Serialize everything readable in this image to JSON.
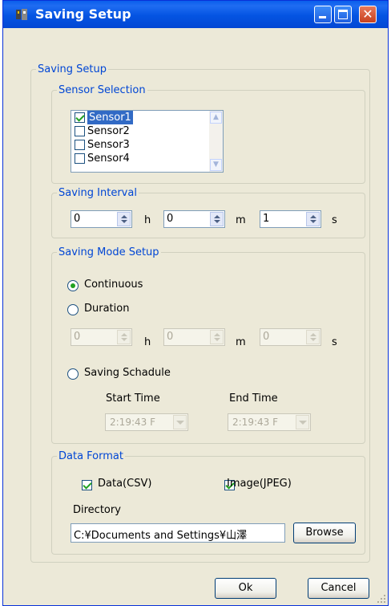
{
  "window": {
    "title": "Saving Setup",
    "close_glyph": "✕",
    "icon": "app-icon",
    "colors": {
      "titlebar": "#0454E2",
      "group_title": "#0046D5",
      "check": "#21A121",
      "selection": "#316AC5"
    }
  },
  "main_group": {
    "title": "Saving Setup"
  },
  "sensor_selection": {
    "title": "Sensor Selection",
    "items": [
      {
        "label": "Sensor1",
        "checked": true,
        "selected": true
      },
      {
        "label": "Sensor2",
        "checked": false,
        "selected": false
      },
      {
        "label": "Sensor3",
        "checked": false,
        "selected": false
      },
      {
        "label": "Sensor4",
        "checked": false,
        "selected": false
      }
    ]
  },
  "saving_interval": {
    "title": "Saving Interval",
    "hours": "0",
    "hours_unit": "h",
    "minutes": "0",
    "minutes_unit": "m",
    "seconds": "1",
    "seconds_unit": "s"
  },
  "saving_mode": {
    "title": "Saving Mode Setup",
    "continuous_label": "Continuous",
    "duration_label": "Duration",
    "selected": "Continuous",
    "duration_hours": "0",
    "duration_hours_unit": "h",
    "duration_minutes": "0",
    "duration_minutes_unit": "m",
    "duration_seconds": "0",
    "duration_seconds_unit": "s",
    "schedule_label": "Saving Schadule",
    "start_time_label": "Start Time",
    "end_time_label": "End Time",
    "start_time_value": "2:19:43 F",
    "end_time_value": "2:19:43 F"
  },
  "data_format": {
    "title": "Data Format",
    "data_csv_label": "Data(CSV)",
    "data_csv_checked": true,
    "image_jpeg_label": "Image(JPEG)",
    "image_jpeg_checked": true,
    "directory_label": "Directory",
    "directory_value": "C:¥Documents and Settings¥山澤",
    "browse_label": "Browse"
  },
  "footer": {
    "ok_label": "Ok",
    "cancel_label": "Cancel"
  }
}
